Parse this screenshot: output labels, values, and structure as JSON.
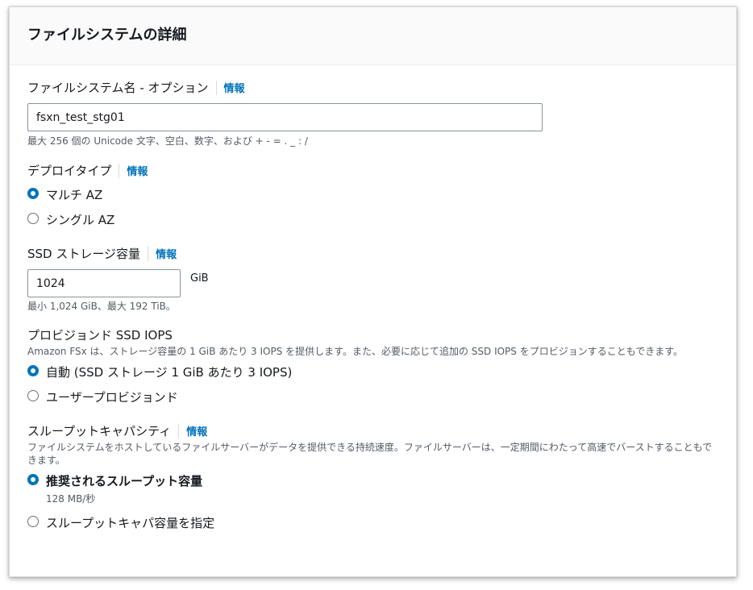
{
  "panel": {
    "title": "ファイルシステムの詳細"
  },
  "info_label": "情報",
  "fs_name": {
    "label": "ファイルシステム名 - オプション",
    "value": "fsxn_test_stg01",
    "constraint": "最大 256 個の Unicode 文字、空白、数字、および + - = . _ : /"
  },
  "deploy_type": {
    "label": "デプロイタイプ",
    "options": [
      {
        "label": "マルチ AZ",
        "checked": true
      },
      {
        "label": "シングル AZ",
        "checked": false
      }
    ]
  },
  "ssd_storage": {
    "label": "SSD ストレージ容量",
    "value": "1024",
    "unit": "GiB",
    "constraint": "最小 1,024 GiB、最大 192 TiB。"
  },
  "iops": {
    "label": "プロビジョンド SSD IOPS",
    "description": "Amazon FSx は、ストレージ容量の 1 GiB あたり 3 IOPS を提供します。また、必要に応じて追加の SSD IOPS をプロビジョンすることもできます。",
    "options": [
      {
        "label": "自動 (SSD ストレージ 1 GiB あたり 3 IOPS)",
        "checked": true
      },
      {
        "label": "ユーザープロビジョンド",
        "checked": false
      }
    ]
  },
  "throughput": {
    "label": "スループットキャパシティ",
    "description": "ファイルシステムをホストしているファイルサーバーがデータを提供できる持続速度。ファイルサーバーは、一定期間にわたって高速でバーストすることもできます。",
    "options": [
      {
        "label": "推奨されるスループット容量",
        "sublabel": "128 MB/秒",
        "checked": true
      },
      {
        "label": "スループットキャパ容量を指定",
        "checked": false
      }
    ]
  }
}
